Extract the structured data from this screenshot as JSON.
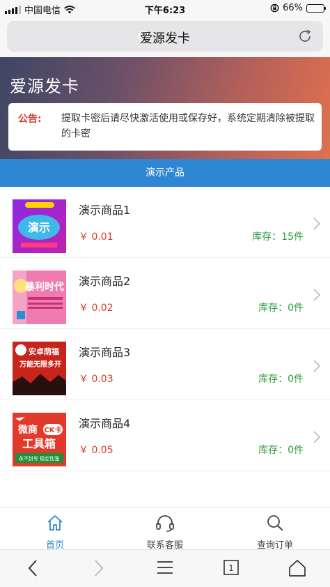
{
  "status_bar": {
    "carrier": "中国电信",
    "time": "下午6:23",
    "battery_percent": "66%",
    "battery_level": 0.66
  },
  "browser": {
    "address_title": "爱源发卡",
    "address_icon": "?",
    "reload_icon": "reload-icon"
  },
  "hero": {
    "title": "爱源发卡",
    "notice_label": "公告:",
    "notice_text": "提取卡密后请尽快激活使用或保存好，系统定期清除被提取的卡密"
  },
  "section": {
    "title": "演示产品"
  },
  "products": [
    {
      "name": "演示商品1",
      "price": "￥ 0.01",
      "stock": "库存：15件"
    },
    {
      "name": "演示商品2",
      "price": "￥ 0.02",
      "stock": "库存：0件"
    },
    {
      "name": "演示商品3",
      "price": "￥ 0.03",
      "stock": "库存：0件"
    },
    {
      "name": "演示商品4",
      "price": "￥ 0.05",
      "stock": "库存：0件"
    }
  ],
  "product_thumbs": {
    "p1": "演示",
    "p2_line1": "暴利时代",
    "p3_line1": "安卓荫福",
    "p3_line2": "万能无限多开",
    "p4_line1": "微商",
    "p4_badge": "CK卡",
    "p4_line2": "工具箱",
    "p4_line3": "永不封号 稳定性强"
  },
  "app_nav": [
    {
      "label": "首页",
      "icon": "home-icon",
      "active": true
    },
    {
      "label": "联系客服",
      "icon": "headset-icon",
      "active": false
    },
    {
      "label": "查询订单",
      "icon": "search-icon",
      "active": false
    }
  ],
  "toolbar": {
    "tabs_count": "1"
  },
  "colors": {
    "accent_blue": "#2f87d3",
    "price_red": "#d93a2b",
    "stock_green": "#2e9b3a"
  }
}
